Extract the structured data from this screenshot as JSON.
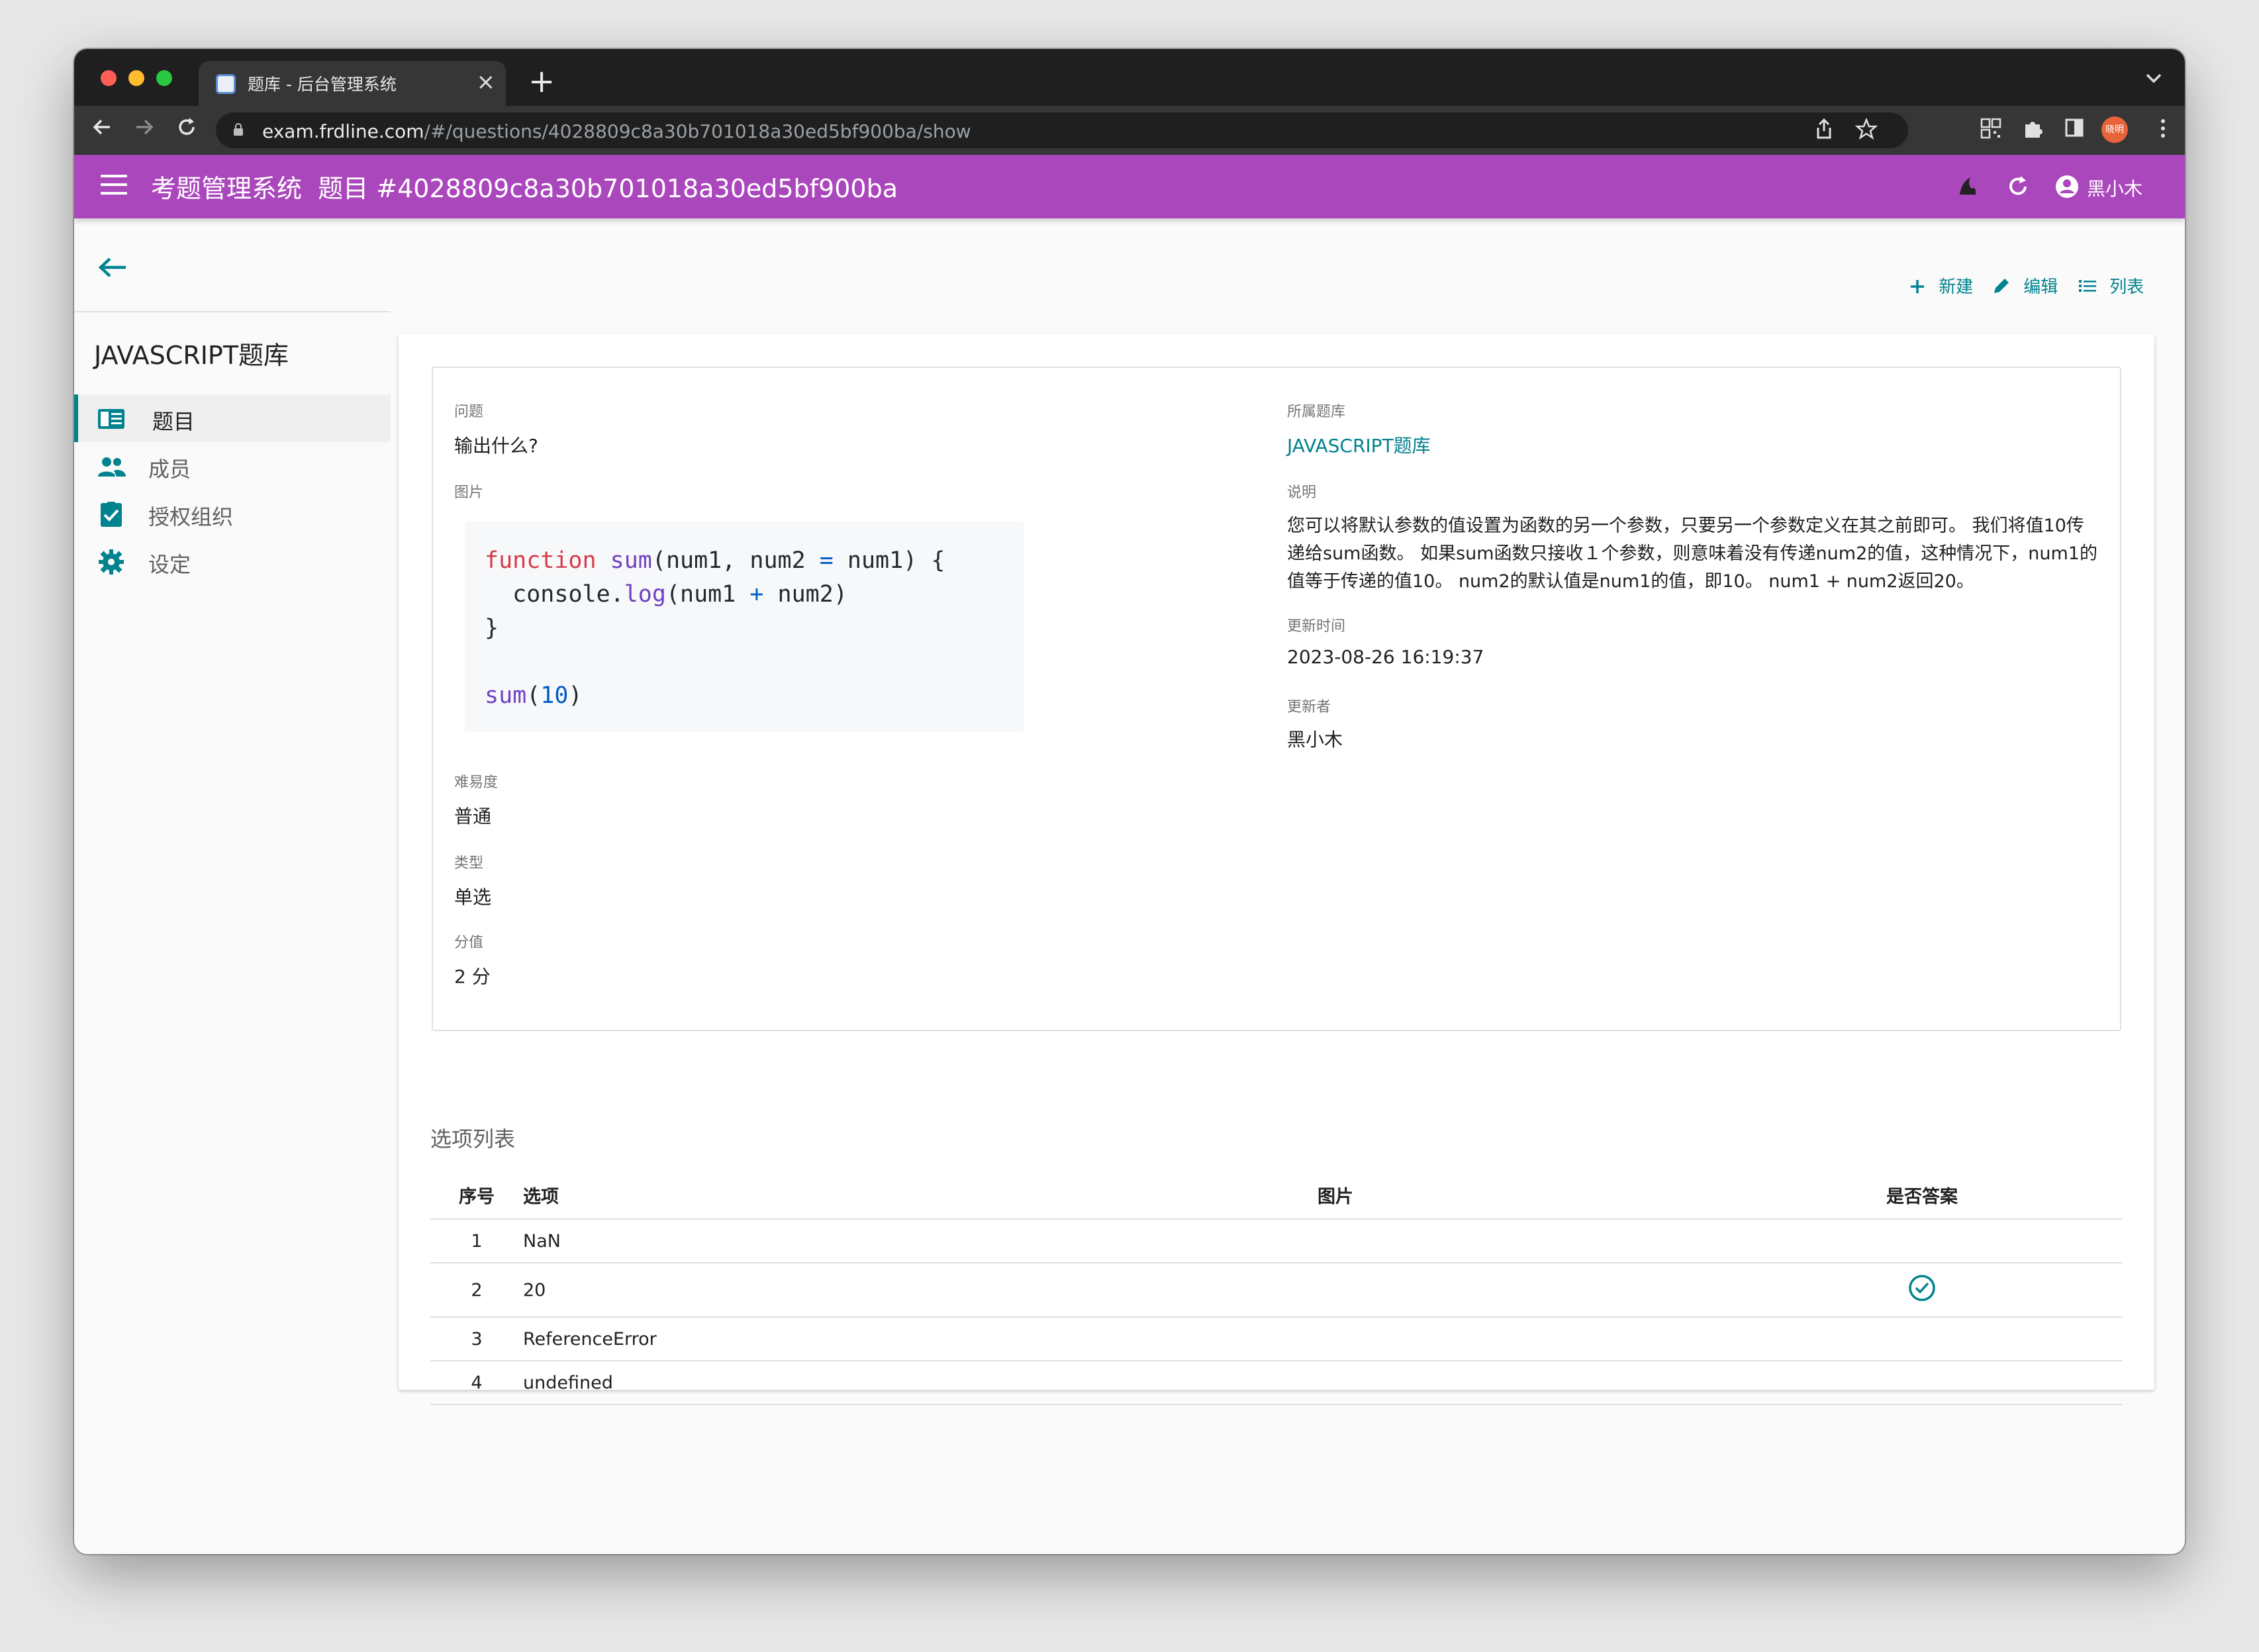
{
  "browser": {
    "tab_title": "题库 - 后台管理系统",
    "tab_close": "×",
    "new_tab": "+",
    "url_host": "exam.frdline.com",
    "url_path": "/#/questions/4028809c8a30b701018a30ed5bf900ba/show",
    "profile_label": "晓明",
    "colors": {
      "close": "#ff5f57",
      "minimize": "#febc2e",
      "maximize": "#28c840"
    }
  },
  "appbar": {
    "title": "考题管理系统",
    "subtitle": "题目 #4028809c8a30b701018a30ed5bf900ba",
    "user": "黑小木",
    "color": "#ab47bc"
  },
  "sidebar": {
    "title": "JAVASCRIPT题库",
    "items": [
      {
        "label": "题目",
        "icon": "question-list-icon",
        "active": true
      },
      {
        "label": "成员",
        "icon": "people-icon",
        "active": false
      },
      {
        "label": "授权组织",
        "icon": "assignment-check-icon",
        "active": false
      },
      {
        "label": "设定",
        "icon": "gear-icon",
        "active": false
      }
    ]
  },
  "actions": {
    "create": "新建",
    "edit": "编辑",
    "list": "列表"
  },
  "question": {
    "question_label": "问题",
    "question_value": "输出什么?",
    "image_label": "图片",
    "code_lines": [
      {
        "kw": "function",
        "fn": "sum",
        "rest": "(num1, num2 ",
        "op": "=",
        "rest2": " num1) {"
      },
      {
        "indent": "  ",
        "obj": "console.",
        "fn": "log",
        "rest": "(num1 ",
        "op": "+",
        "rest2": " num2)"
      },
      {
        "rest": "}"
      },
      {
        "fn": "sum",
        "rest": "(",
        "num": "10",
        "rest2": ")"
      }
    ],
    "difficulty_label": "难易度",
    "difficulty_value": "普通",
    "type_label": "类型",
    "type_value": "单选",
    "score_label": "分值",
    "score_value": "2 分",
    "bank_label": "所属题库",
    "bank_value": "JAVASCRIPT题库",
    "explain_label": "说明",
    "explain_value": "您可以将默认参数的值设置为函数的另一个参数，只要另一个参数定义在其之前即可。 我们将值10传递给sum函数。 如果sum函数只接收１个参数，则意味着没有传递num2的值，这种情况下，num1的值等于传递的值10。 num2的默认值是num1的值，即10。 num1 + num2返回20。",
    "updated_label": "更新时间",
    "updated_value": "2023-08-26 16:19:37",
    "updater_label": "更新者",
    "updater_value": "黑小木"
  },
  "options": {
    "title": "选项列表",
    "headers": {
      "index": "序号",
      "option": "选项",
      "image": "图片",
      "answer": "是否答案"
    },
    "rows": [
      {
        "index": "1",
        "option": "NaN",
        "is_answer": false
      },
      {
        "index": "2",
        "option": "20",
        "is_answer": true
      },
      {
        "index": "3",
        "option": "ReferenceError",
        "is_answer": false
      },
      {
        "index": "4",
        "option": "undefined",
        "is_answer": false
      }
    ]
  }
}
